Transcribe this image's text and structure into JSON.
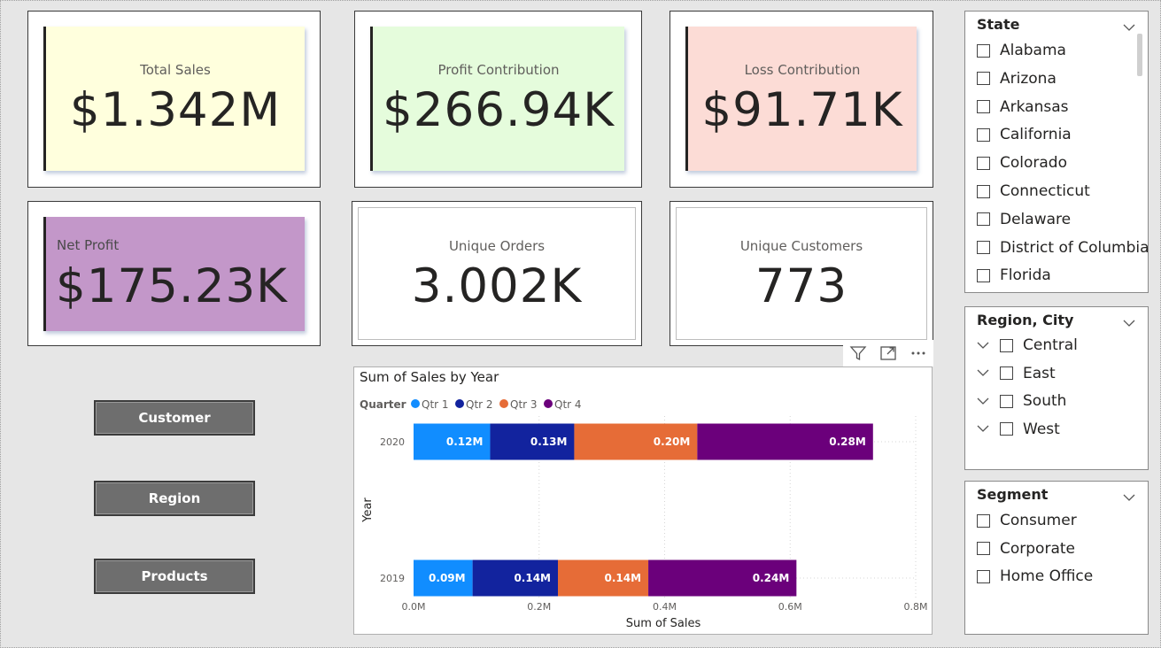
{
  "kpis": {
    "total_sales": {
      "label": "Total Sales",
      "value": "$1.342M",
      "color": "#ffffdd"
    },
    "profit_contribution": {
      "label": "Profit Contribution",
      "value": "$266.94K",
      "color": "#e5fcdc"
    },
    "loss_contribution": {
      "label": "Loss Contribution",
      "value": "$91.71K",
      "color": "#fcdcd6"
    },
    "net_profit": {
      "label": "Net Profit",
      "value": "$175.23K",
      "color": "#c397c9"
    },
    "unique_orders": {
      "label": "Unique Orders",
      "value": "3.002K"
    },
    "unique_customers": {
      "label": "Unique Customers",
      "value": "773"
    }
  },
  "nav": {
    "customer": "Customer",
    "region": "Region",
    "products": "Products"
  },
  "chart_toolbar": {
    "icons": [
      "filter-icon",
      "focus-mode-icon",
      "more-options-icon"
    ]
  },
  "chart_data": {
    "type": "bar",
    "orientation": "horizontal",
    "stacked": true,
    "title": "Sum of Sales by Year",
    "xlabel": "Sum of Sales",
    "ylabel": "Year",
    "legend_title": "Quarter",
    "legend_position": "top-left",
    "categories": [
      "2020",
      "2019"
    ],
    "xlim": [
      0,
      0.8
    ],
    "x_ticks": [
      "0.0M",
      "0.2M",
      "0.4M",
      "0.6M",
      "0.8M"
    ],
    "grid": true,
    "series": [
      {
        "name": "Qtr 1",
        "color": "#118dff",
        "values": [
          0.122,
          0.094
        ],
        "labels": [
          "0.12M",
          "0.09M"
        ]
      },
      {
        "name": "Qtr 2",
        "color": "#12239e",
        "values": [
          0.134,
          0.136
        ],
        "labels": [
          "0.13M",
          "0.14M"
        ]
      },
      {
        "name": "Qtr 3",
        "color": "#e66c37",
        "values": [
          0.196,
          0.144
        ],
        "labels": [
          "0.20M",
          "0.14M"
        ]
      },
      {
        "name": "Qtr 4",
        "color": "#6b007b",
        "values": [
          0.28,
          0.236
        ],
        "labels": [
          "0.28M",
          "0.24M"
        ]
      }
    ]
  },
  "slicers": {
    "state": {
      "title": "State",
      "items": [
        "Alabama",
        "Arizona",
        "Arkansas",
        "California",
        "Colorado",
        "Connecticut",
        "Delaware",
        "District of Columbia",
        "Florida"
      ]
    },
    "region_city": {
      "title": "Region, City",
      "items": [
        "Central",
        "East",
        "South",
        "West"
      ]
    },
    "segment": {
      "title": "Segment",
      "items": [
        "Consumer",
        "Corporate",
        "Home Office"
      ]
    }
  }
}
